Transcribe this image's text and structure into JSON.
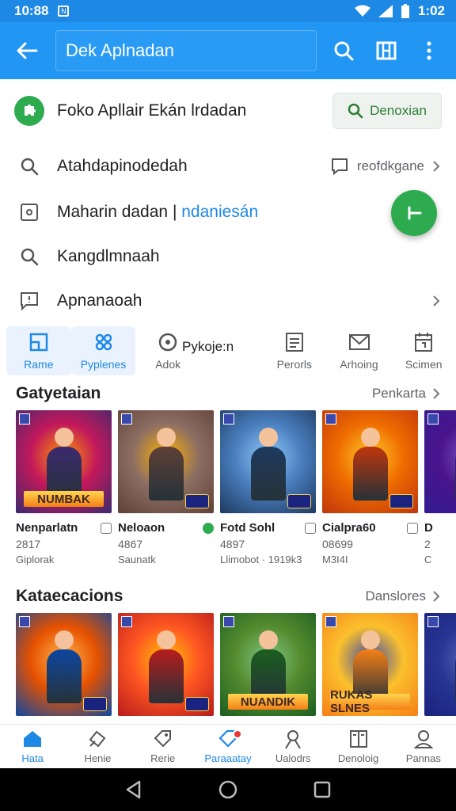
{
  "status_bar": {
    "time": "10:88",
    "right_time": "1:02"
  },
  "app_bar": {
    "search_text": "Dek Aplnadan"
  },
  "promo": {
    "text": "Foko Apllair Ekán lrdadan",
    "button": "Denoxian"
  },
  "menu": [
    {
      "label": "Atahdapinodedah",
      "side": "reofdkgane"
    },
    {
      "label": "Maharin dadan",
      "link": "ndaniesán"
    },
    {
      "label": "Kangdlmnaah"
    },
    {
      "label": "Apnanaoah"
    }
  ],
  "categories": [
    {
      "label": "Rame",
      "icon": "square-icon",
      "active": true
    },
    {
      "label": "Pyplenes",
      "icon": "puzzle-icon",
      "active": true
    },
    {
      "label": "Adok",
      "icon": "circle-icon"
    },
    {
      "label": "Perorls",
      "icon": "document-icon"
    },
    {
      "label": "Arhoing",
      "icon": "mail-icon"
    },
    {
      "label": "Scimen",
      "icon": "calendar-icon"
    }
  ],
  "category_special": "Pykoje:n",
  "section1": {
    "title": "Gatyetaian",
    "more": "Penkarta",
    "cards": [
      {
        "name": "Nenparlatn",
        "num": "2817",
        "sub": "Giplorak",
        "tag": "NUMBAK",
        "colors": [
          "#3b2a6e",
          "#c2185b",
          "#ff9800"
        ]
      },
      {
        "name": "Neloaon",
        "num": "4867",
        "sub": "Saunatk",
        "tag": "",
        "colors": [
          "#5d4037",
          "#8d6e63",
          "#ffb300"
        ]
      },
      {
        "name": "Fotd Sohl",
        "num": "4897",
        "sub": "Llimobot · 1919k3",
        "tag": "",
        "colors": [
          "#1e3a5f",
          "#4a7fbf",
          "#90caf9"
        ]
      },
      {
        "name": "Cialpra60",
        "num": "08699",
        "sub": "M3I4I",
        "tag": "",
        "colors": [
          "#bf360c",
          "#ef6c00",
          "#ffca28"
        ]
      },
      {
        "name": "D",
        "num": "2",
        "sub": "C",
        "tag": "",
        "colors": [
          "#311b92",
          "#4a148c",
          "#7e57c2"
        ]
      }
    ]
  },
  "section2": {
    "title": "Kataecacions",
    "more": "Danslores",
    "cards": [
      {
        "tag": "",
        "colors": [
          "#0d47a1",
          "#e65100",
          "#ffb74d"
        ]
      },
      {
        "tag": "",
        "colors": [
          "#b71c1c",
          "#ff5722",
          "#ffc107"
        ]
      },
      {
        "tag": "NUANDIK",
        "colors": [
          "#1b5e20",
          "#558b2f",
          "#81c784"
        ]
      },
      {
        "tag": "RUKAS SLNES",
        "colors": [
          "#f57f17",
          "#fbc02d",
          "#3949ab"
        ]
      },
      {
        "tag": "",
        "colors": [
          "#1a237e",
          "#283593",
          "#5c6bc0"
        ]
      }
    ]
  },
  "bottom_nav": [
    {
      "label": "Hata",
      "icon": "home-icon",
      "active": true
    },
    {
      "label": "Henie",
      "icon": "hands-icon"
    },
    {
      "label": "Rerie",
      "icon": "tag-icon"
    },
    {
      "label": "Paraaatay",
      "icon": "gift-icon",
      "badge": true
    },
    {
      "label": "Ualodrs",
      "icon": "person-icon"
    },
    {
      "label": "Denoloig",
      "icon": "book-icon"
    },
    {
      "label": "Pannas",
      "icon": "account-icon"
    }
  ],
  "colors": {
    "primary": "#2196f3",
    "green": "#2eaa4f",
    "text": "#202124",
    "muted": "#5f6368"
  }
}
